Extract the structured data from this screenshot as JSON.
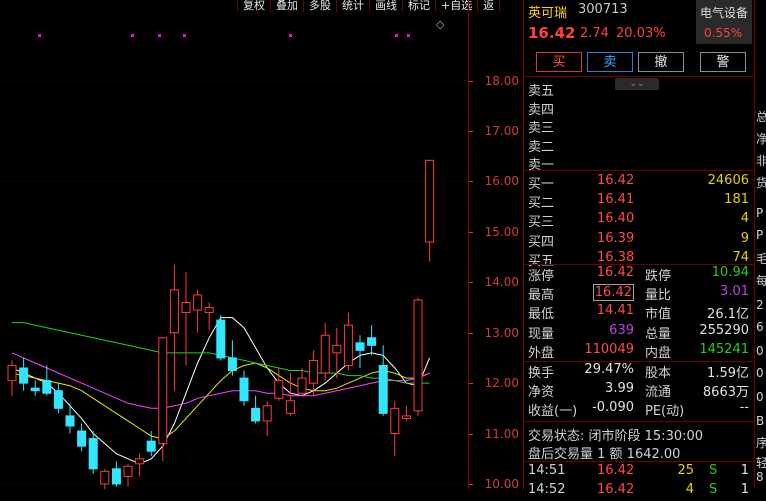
{
  "toolbar": [
    "复权",
    "叠加",
    "多股",
    "统计",
    "画线",
    "标记",
    "+自选",
    "返"
  ],
  "y_axis": [
    "18.00",
    "17.00",
    "16.00",
    "15.00",
    "14.00",
    "13.00",
    "12.00",
    "11.00",
    "10.00"
  ],
  "chart_data": {
    "type": "candlestick",
    "ylim": [
      9.9,
      19.6
    ],
    "candles": [
      {
        "o": 12.05,
        "h": 12.45,
        "l": 11.75,
        "c": 12.35
      },
      {
        "o": 12.3,
        "h": 12.5,
        "l": 11.85,
        "c": 12.0
      },
      {
        "o": 11.9,
        "h": 12.05,
        "l": 11.75,
        "c": 11.85
      },
      {
        "o": 12.05,
        "h": 12.35,
        "l": 11.75,
        "c": 11.8
      },
      {
        "o": 11.85,
        "h": 12.0,
        "l": 11.4,
        "c": 11.5
      },
      {
        "o": 11.35,
        "h": 11.6,
        "l": 11.0,
        "c": 11.15
      },
      {
        "o": 11.05,
        "h": 11.2,
        "l": 10.65,
        "c": 10.75
      },
      {
        "o": 10.9,
        "h": 11.05,
        "l": 10.2,
        "c": 10.3
      },
      {
        "o": 10.0,
        "h": 10.3,
        "l": 9.85,
        "c": 10.25
      },
      {
        "o": 10.3,
        "h": 10.45,
        "l": 9.95,
        "c": 10.0
      },
      {
        "o": 10.15,
        "h": 10.4,
        "l": 9.95,
        "c": 10.35
      },
      {
        "o": 10.4,
        "h": 10.6,
        "l": 10.15,
        "c": 10.5
      },
      {
        "o": 10.85,
        "h": 11.05,
        "l": 10.55,
        "c": 10.65
      },
      {
        "o": 10.8,
        "h": 11.1,
        "l": 10.45,
        "c": 12.9
      },
      {
        "o": 13.0,
        "h": 14.35,
        "l": 11.85,
        "c": 13.85
      },
      {
        "o": 13.4,
        "h": 14.2,
        "l": 12.35,
        "c": 13.6
      },
      {
        "o": 13.45,
        "h": 13.85,
        "l": 13.0,
        "c": 13.75
      },
      {
        "o": 13.4,
        "h": 13.6,
        "l": 13.05,
        "c": 13.5
      },
      {
        "o": 13.25,
        "h": 13.35,
        "l": 12.45,
        "c": 12.5
      },
      {
        "o": 12.5,
        "h": 12.85,
        "l": 12.15,
        "c": 12.25
      },
      {
        "o": 12.1,
        "h": 12.25,
        "l": 11.55,
        "c": 11.65
      },
      {
        "o": 11.5,
        "h": 11.75,
        "l": 11.2,
        "c": 11.25
      },
      {
        "o": 11.25,
        "h": 11.65,
        "l": 10.95,
        "c": 11.55
      },
      {
        "o": 11.7,
        "h": 12.3,
        "l": 11.65,
        "c": 12.05
      },
      {
        "o": 11.4,
        "h": 12.2,
        "l": 11.35,
        "c": 11.65
      },
      {
        "o": 11.8,
        "h": 12.3,
        "l": 11.75,
        "c": 12.1
      },
      {
        "o": 12.0,
        "h": 12.65,
        "l": 11.75,
        "c": 12.45
      },
      {
        "o": 12.2,
        "h": 13.2,
        "l": 12.05,
        "c": 12.95
      },
      {
        "o": 12.6,
        "h": 13.1,
        "l": 12.1,
        "c": 12.75
      },
      {
        "o": 12.35,
        "h": 13.4,
        "l": 12.25,
        "c": 13.15
      },
      {
        "o": 12.8,
        "h": 12.95,
        "l": 12.3,
        "c": 12.65
      },
      {
        "o": 12.9,
        "h": 13.15,
        "l": 12.55,
        "c": 12.75
      },
      {
        "o": 12.35,
        "h": 12.75,
        "l": 11.35,
        "c": 11.4
      },
      {
        "o": 11.0,
        "h": 11.65,
        "l": 10.55,
        "c": 11.5
      },
      {
        "o": 11.3,
        "h": 11.55,
        "l": 11.25,
        "c": 11.35
      },
      {
        "o": 11.45,
        "h": 13.7,
        "l": 11.35,
        "c": 13.65
      },
      {
        "o": 14.8,
        "h": 16.42,
        "l": 14.41,
        "c": 16.42
      }
    ],
    "ma_series": [
      {
        "color": "#ffffff",
        "values": [
          12.3,
          12.2,
          12.1,
          12.0,
          11.8,
          11.55,
          11.3,
          11.0,
          10.8,
          10.6,
          10.5,
          10.4,
          10.5,
          10.75,
          11.2,
          11.8,
          12.4,
          12.9,
          13.3,
          13.3,
          13.1,
          12.7,
          12.3,
          12.0,
          11.8,
          11.75,
          11.85,
          12.0,
          12.2,
          12.4,
          12.55,
          12.6,
          12.55,
          12.3,
          12.0,
          11.95,
          12.5
        ]
      },
      {
        "color": "#e5e500",
        "values": [
          12.2,
          12.15,
          12.1,
          12.05,
          12.0,
          11.95,
          11.85,
          11.7,
          11.55,
          11.4,
          11.25,
          11.1,
          10.95,
          10.9,
          11.05,
          11.3,
          11.55,
          11.8,
          12.05,
          12.25,
          12.35,
          12.4,
          12.3,
          12.15,
          12.0,
          11.9,
          11.85,
          11.85,
          11.9,
          12.0,
          12.1,
          12.2,
          12.25,
          12.2,
          12.1,
          12.1,
          12.2
        ]
      },
      {
        "color": "#ff40ff",
        "values": [
          12.6,
          12.5,
          12.4,
          12.3,
          12.2,
          12.1,
          12.0,
          11.9,
          11.8,
          11.7,
          11.6,
          11.55,
          11.5,
          11.5,
          11.55,
          11.6,
          11.7,
          11.75,
          11.8,
          11.85,
          11.85,
          11.85,
          11.8,
          11.8,
          11.75,
          11.75,
          11.75,
          11.8,
          11.85,
          11.9,
          11.95,
          12.0,
          12.05,
          12.05,
          12.05,
          12.1,
          12.2
        ]
      },
      {
        "color": "#20d020",
        "values": [
          13.2,
          13.2,
          13.15,
          13.1,
          13.05,
          13.0,
          12.95,
          12.9,
          12.85,
          12.8,
          12.75,
          12.7,
          12.65,
          12.6,
          12.6,
          12.6,
          12.6,
          12.6,
          12.55,
          12.5,
          12.45,
          12.4,
          12.35,
          12.3,
          12.25,
          12.25,
          12.2,
          12.2,
          12.2,
          12.15,
          12.15,
          12.1,
          12.1,
          12.05,
          12.0,
          12.0,
          12.0
        ]
      }
    ]
  },
  "panel": {
    "name": "英可瑞",
    "code": "300713",
    "price": "16.42",
    "change": "2.74",
    "change_pct": "20.03%",
    "sector": "电气设备",
    "sector_pct": "0.55%",
    "buttons": [
      "买",
      "卖",
      "撤",
      "警"
    ],
    "expand": "⌄⌄",
    "asks": [
      "卖五",
      "卖四",
      "卖三",
      "卖二",
      "卖一"
    ],
    "bids": [
      {
        "label": "买一",
        "price": "16.42",
        "vol": "24606"
      },
      {
        "label": "买二",
        "price": "16.41",
        "vol": "181"
      },
      {
        "label": "买三",
        "price": "16.40",
        "vol": "4"
      },
      {
        "label": "买四",
        "price": "16.39",
        "vol": "9"
      },
      {
        "label": "买五",
        "price": "16.38",
        "vol": "74"
      }
    ],
    "stats": [
      {
        "l1": "涨停",
        "v1": "16.42",
        "l2": "跌停",
        "v2": "10.94"
      },
      {
        "l1": "最高",
        "v1": "16.42",
        "l2": "量比",
        "v2": "3.01"
      },
      {
        "l1": "最低",
        "v1": "14.41",
        "l2": "市值",
        "v2": "26.1亿"
      },
      {
        "l1": "现量",
        "v1": "639",
        "l2": "总量",
        "v2": "255290"
      },
      {
        "l1": "外盘",
        "v1": "110049",
        "l2": "内盘",
        "v2": "145241"
      }
    ],
    "stats2": [
      {
        "l1": "换手",
        "v1": "29.47%",
        "l2": "股本",
        "v2": "1.59亿"
      },
      {
        "l1": "净资",
        "v1": "3.99",
        "l2": "流通",
        "v2": "8663万"
      },
      {
        "l1": "收益(一)",
        "v1": "-0.090",
        "l2": "PE(动)",
        "v2": "--"
      }
    ],
    "status": "交易状态: 闭市阶段 15:30:00",
    "after": "盘后交易量 1 额 1642.00",
    "ticks": [
      {
        "time": "14:51",
        "price": "16.42",
        "vol": "25",
        "side": "S",
        "n": "1"
      },
      {
        "time": "14:52",
        "price": "16.42",
        "vol": "4",
        "side": "S",
        "n": "1"
      }
    ]
  },
  "far_right": [
    "总",
    "净",
    "非",
    "货",
    "P",
    "P",
    "毛",
    "每",
    "2",
    "6",
    "0",
    "0",
    "0",
    "B",
    "序",
    "轻",
    "8"
  ]
}
